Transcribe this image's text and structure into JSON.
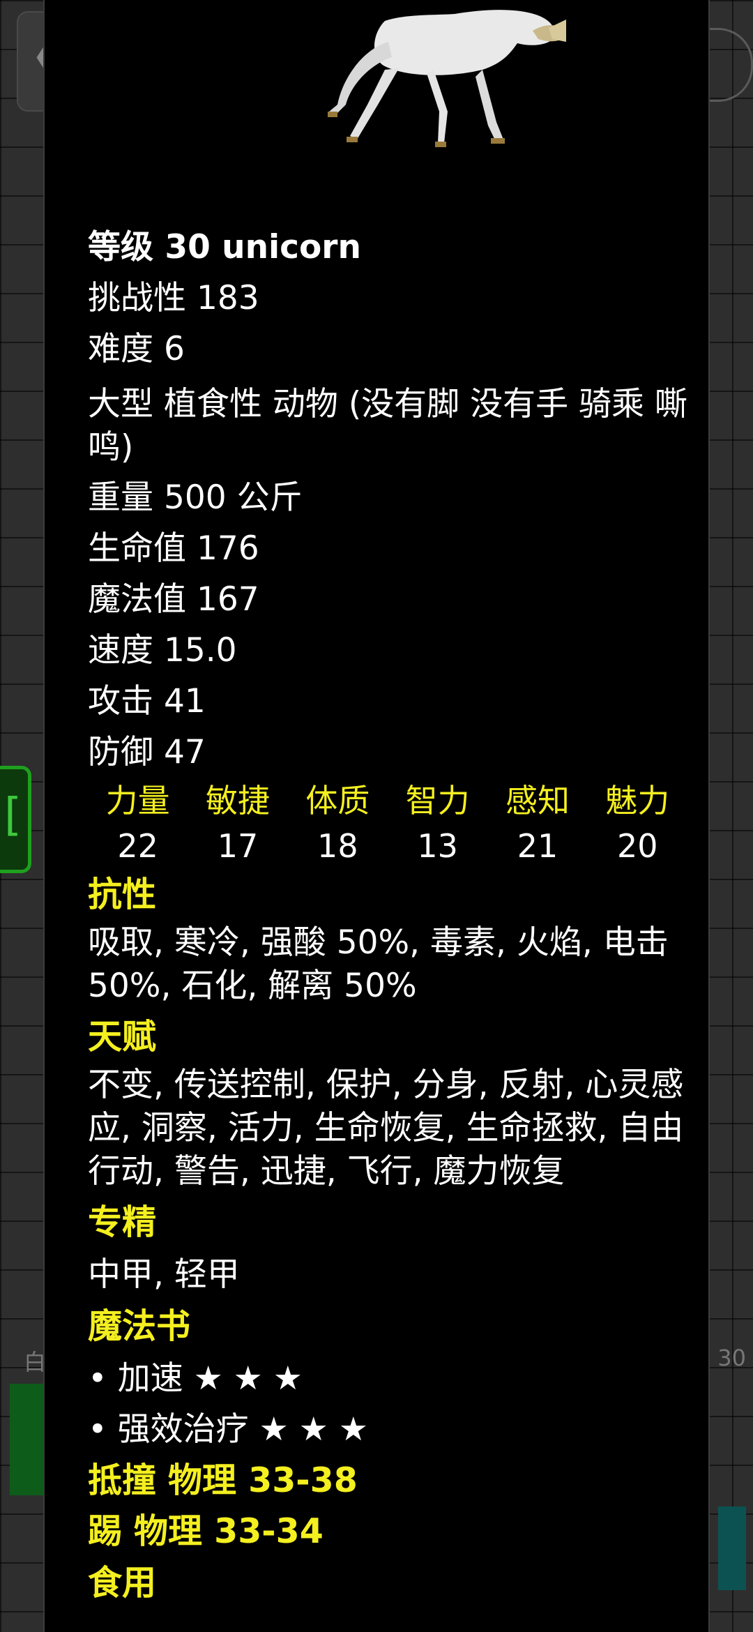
{
  "background": {
    "back_glyph": "❮",
    "bracket_glyph": "[",
    "bottom_left_text": "白",
    "bottom_right_text": "30"
  },
  "monster": {
    "title": "等级 30 unicorn",
    "challenge": "挑战性 183",
    "difficulty": "难度 6",
    "type_desc": "大型 植食性 动物 (没有脚 没有手 骑乘 嘶鸣)",
    "weight": "重量 500 公斤",
    "hp": "生命值 176",
    "mp": "魔法值 167",
    "speed": "速度 15.0",
    "attack": "攻击 41",
    "defense": "防御 47"
  },
  "stats": {
    "headers": [
      "力量",
      "敏捷",
      "体质",
      "智力",
      "感知",
      "魅力"
    ],
    "values": [
      "22",
      "17",
      "18",
      "13",
      "21",
      "20"
    ]
  },
  "sections": {
    "resist_title": "抗性",
    "resist_text": "吸取, 寒冷, 强酸 50%, 毒素, 火焰, 电击 50%, 石化, 解离 50%",
    "talents_title": "天赋",
    "talents_text": "不变, 传送控制, 保护, 分身, 反射, 心灵感应, 洞察, 活力, 生命恢复, 生命拯救, 自由行动, 警告, 迅捷, 飞行, 魔力恢复",
    "mastery_title": "专精",
    "mastery_text": "中甲, 轻甲",
    "spellbook_title": "魔法书",
    "spells": [
      "• 加速 ★ ★ ★",
      "• 强效治疗 ★ ★ ★"
    ],
    "attacks": [
      "抵撞 物理 33-38",
      "踢 物理 33-34"
    ],
    "cut_off_heading": "食用"
  },
  "colors": {
    "accent_yellow": "#f4ef1f",
    "panel_bg": "#000000",
    "text": "#ffffff"
  }
}
